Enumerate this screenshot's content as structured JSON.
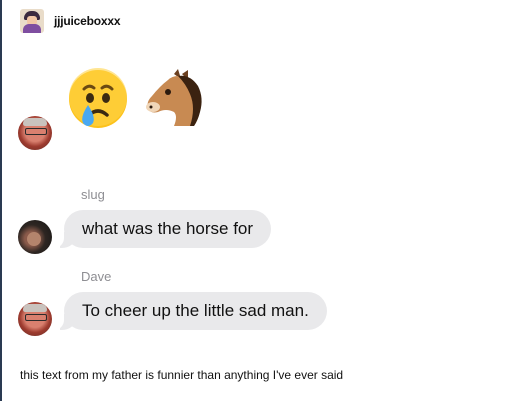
{
  "post": {
    "username": "jjjuiceboxxx",
    "caption": "this text from my father is funnier than anything I've ever said"
  },
  "conversation": {
    "emoji_message": {
      "emojis": [
        "crying-face",
        "horse-face"
      ]
    },
    "messages": [
      {
        "sender": "slug",
        "text": "what was the horse for"
      },
      {
        "sender": "Dave",
        "text": "To cheer up the little sad man."
      }
    ]
  },
  "colors": {
    "bubble": "#e9e9eb",
    "sender_label": "#8e8e93",
    "text": "#111111"
  }
}
